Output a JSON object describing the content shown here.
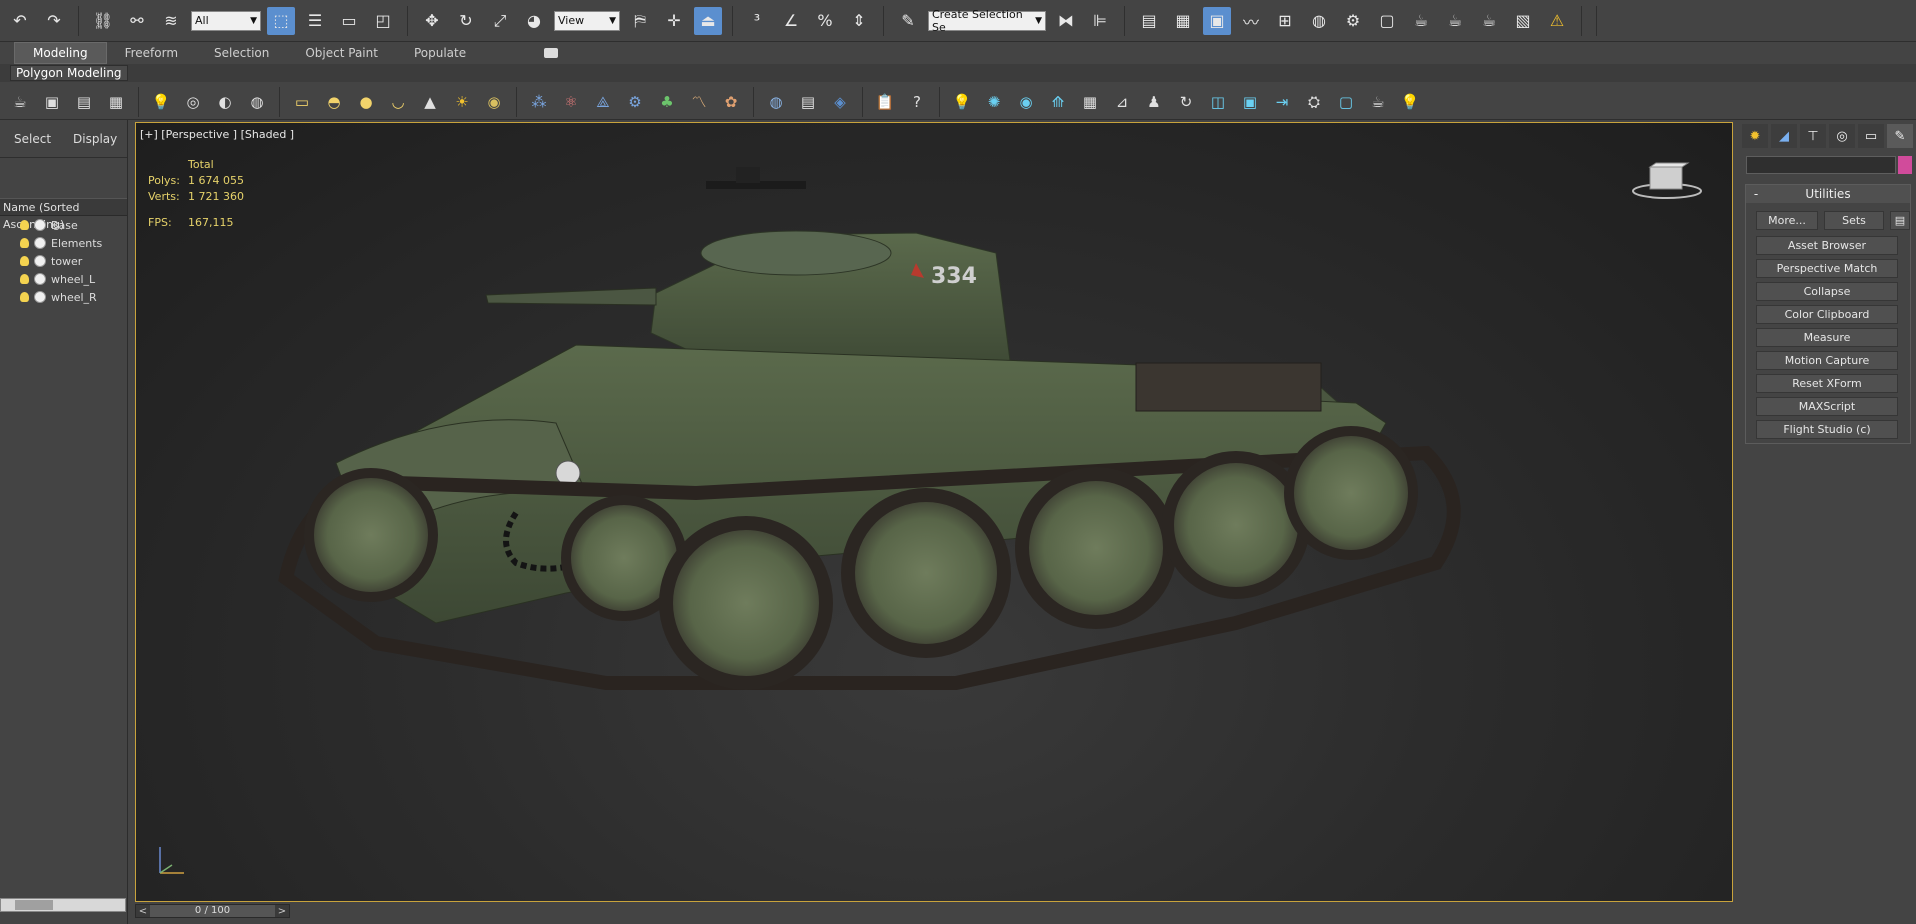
{
  "toolbar": {
    "selection_filter": "All",
    "reference_coord": "View",
    "selection_set_placeholder": "Create Selection Se"
  },
  "ribbon": {
    "tabs": [
      {
        "label": "Modeling",
        "active": true
      },
      {
        "label": "Freeform",
        "active": false
      },
      {
        "label": "Selection",
        "active": false
      },
      {
        "label": "Object Paint",
        "active": false
      },
      {
        "label": "Populate",
        "active": false
      }
    ],
    "sub_label": "Polygon Modeling"
  },
  "scene_explorer": {
    "tabs": [
      "Select",
      "Display"
    ],
    "column_header": "Name (Sorted Ascending)",
    "items": [
      "Base",
      "Elements",
      "tower",
      "wheel_L",
      "wheel_R"
    ]
  },
  "viewport": {
    "label": "[+] [Perspective ] [Shaded ]",
    "stats": {
      "total_label": "Total",
      "polys_label": "Polys:",
      "polys_value": "1 674 055",
      "verts_label": "Verts:",
      "verts_value": "1 721 360",
      "fps_label": "FPS:",
      "fps_value": "167,115"
    },
    "tank_number": "334"
  },
  "timeline": {
    "frame": "0 / 100"
  },
  "command_panel": {
    "rollout_title": "Utilities",
    "more_label": "More...",
    "sets_label": "Sets",
    "utilities": [
      "Asset Browser",
      "Perspective Match",
      "Collapse",
      "Color Clipboard",
      "Measure",
      "Motion Capture",
      "Reset XForm",
      "MAXScript",
      "Flight Studio (c)"
    ]
  },
  "colors": {
    "viewport_border": "#c8a33c",
    "stats_text": "#e6d26a",
    "accent_blue": "#5b8fcf",
    "color_swatch": "#d14b9b"
  }
}
